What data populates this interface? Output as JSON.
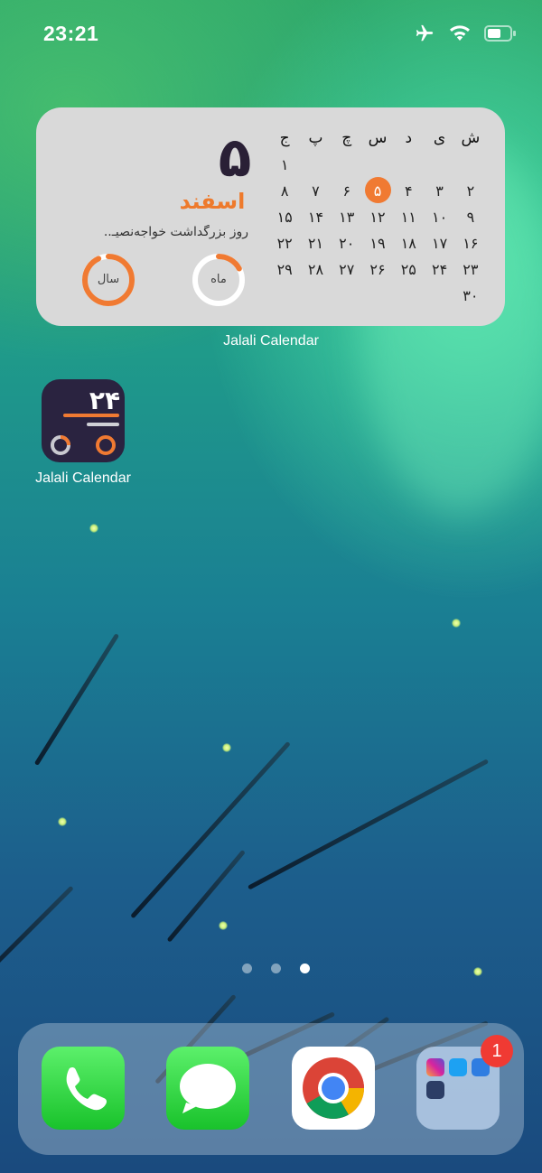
{
  "status_bar": {
    "time": "23:21",
    "icons": [
      "airplane-icon",
      "wifi-icon",
      "battery-icon"
    ]
  },
  "widget": {
    "day_number": "۵",
    "month_name": "اسفند",
    "occasion": "روز بزرگداشت خواجه‌نصیـ..",
    "ring_month": {
      "label": "ماه",
      "fraction": 0.17,
      "color": "#f07a32"
    },
    "ring_year": {
      "label": "سال",
      "fraction": 0.93,
      "color": "#f07a32"
    },
    "weekday_headers": [
      "ش",
      "ی",
      "د",
      "س",
      "چ",
      "پ",
      "ج"
    ],
    "weeks": [
      [
        "",
        "",
        "",
        "",
        "",
        "",
        "۱"
      ],
      [
        "۲",
        "۳",
        "۴",
        "۵",
        "۶",
        "۷",
        "۸"
      ],
      [
        "۹",
        "۱۰",
        "۱۱",
        "۱۲",
        "۱۳",
        "۱۴",
        "۱۵"
      ],
      [
        "۱۶",
        "۱۷",
        "۱۸",
        "۱۹",
        "۲۰",
        "۲۱",
        "۲۲"
      ],
      [
        "۲۳",
        "۲۴",
        "۲۵",
        "۲۶",
        "۲۷",
        "۲۸",
        "۲۹"
      ],
      [
        "۳۰",
        "",
        "",
        "",
        "",
        "",
        ""
      ]
    ],
    "today": "۵",
    "caption": "Jalali Calendar"
  },
  "app": {
    "label": "Jalali Calendar",
    "icon_number": "۲۴"
  },
  "page_dots": {
    "count": 3,
    "active": 3
  },
  "dock": {
    "apps": [
      "phone-icon",
      "messages-icon",
      "chrome-icon",
      "folder-icon"
    ],
    "folder_badge": "1"
  }
}
